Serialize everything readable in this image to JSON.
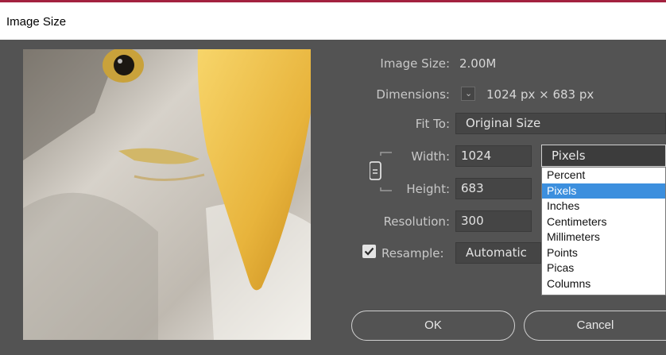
{
  "window": {
    "title": "Image Size"
  },
  "info": {
    "image_size_label": "Image Size:",
    "image_size_value": "2.00M",
    "dimensions_label": "Dimensions:",
    "dimensions_value": "1024 px × 683 px"
  },
  "fit_to": {
    "label": "Fit To:",
    "value": "Original Size"
  },
  "width": {
    "label": "Width:",
    "value": "1024"
  },
  "height": {
    "label": "Height:",
    "value": "683"
  },
  "resolution": {
    "label": "Resolution:",
    "value": "300"
  },
  "resample": {
    "label": "Resample:",
    "checked": true,
    "value": "Automatic"
  },
  "units": {
    "selected": "Pixels",
    "options": [
      "Percent",
      "Pixels",
      "Inches",
      "Centimeters",
      "Millimeters",
      "Points",
      "Picas",
      "Columns"
    ]
  },
  "buttons": {
    "ok": "OK",
    "cancel": "Cancel"
  },
  "colors": {
    "dialog_bg": "#535353",
    "field_bg": "#454545",
    "selection": "#3c8fde",
    "title_accent": "#a3223f"
  }
}
